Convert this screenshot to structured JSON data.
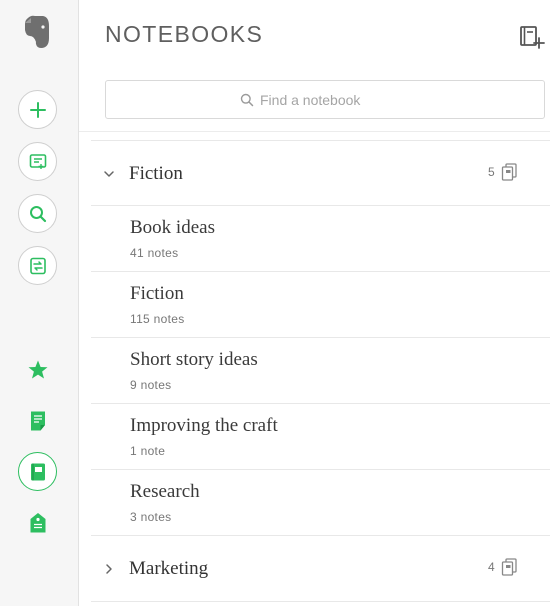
{
  "header": {
    "title": "NOTEBOOKS"
  },
  "search": {
    "placeholder": "Find a notebook"
  },
  "stacks": [
    {
      "name": "Fiction",
      "count": "5",
      "expanded": true,
      "notebooks": [
        {
          "name": "Book ideas",
          "count": "41 notes"
        },
        {
          "name": "Fiction",
          "count": "115 notes"
        },
        {
          "name": "Short story ideas",
          "count": "9 notes"
        },
        {
          "name": "Improving the craft",
          "count": "1 note"
        },
        {
          "name": "Research",
          "count": "3 notes"
        }
      ]
    },
    {
      "name": "Marketing",
      "count": "4",
      "expanded": false,
      "notebooks": []
    }
  ],
  "rail": {
    "icons": [
      "evernote-logo",
      "new-note-icon",
      "work-chat-icon",
      "search-icon",
      "switch-icon",
      "shortcuts-icon",
      "notes-icon",
      "notebooks-icon",
      "tags-icon"
    ]
  },
  "colors": {
    "accent": "#2dbe60",
    "rail_bg": "#f6f6f6",
    "title": "#5f5f5f"
  }
}
